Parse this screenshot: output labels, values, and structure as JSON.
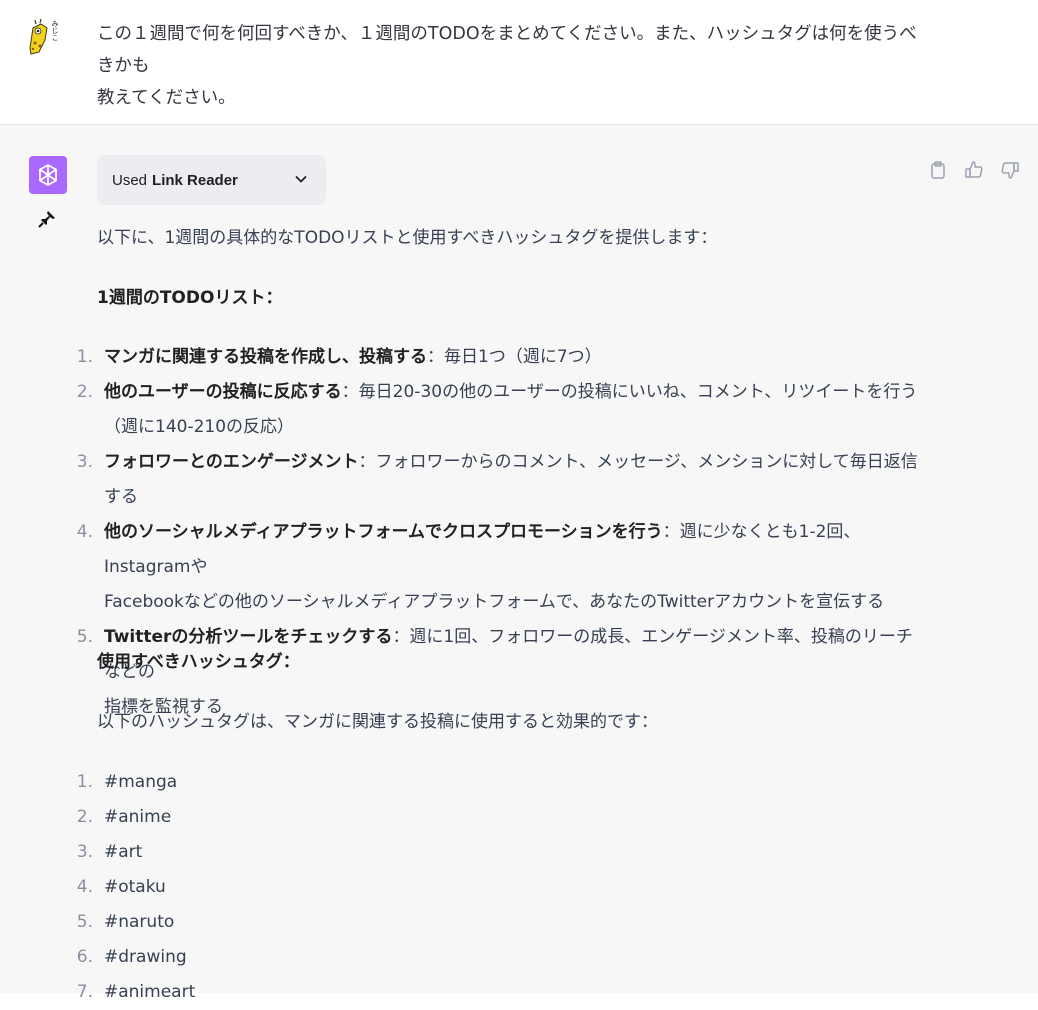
{
  "user": {
    "avatar_icon": "giraffe-avatar-icon",
    "avatar_text": "みじこ",
    "message_line1": "この１週間で何を何回すべきか、１週間のTODOをまとめてください。また、ハッシュタグは何を使うべきかも",
    "message_line2": "教えてください。"
  },
  "assistant": {
    "avatar_icon": "openai-logo-icon",
    "pin_icon": "pin-icon",
    "plugin": {
      "used_label": "Used",
      "name": "Link Reader",
      "chevron_icon": "chevron-down-icon"
    },
    "actions": {
      "copy_icon": "clipboard-icon",
      "like_icon": "thumbs-up-icon",
      "dislike_icon": "thumbs-down-icon"
    },
    "intro": "以下に、1週間の具体的なTODOリストと使用すべきハッシュタグを提供します：",
    "todo_heading": "1週間のTODOリスト：",
    "todos": [
      {
        "num": "1.",
        "title": "マンガに関連する投稿を作成し、投稿する",
        "line1": "：毎日1つ（週に7つ）",
        "line2": ""
      },
      {
        "num": "2.",
        "title": "他のユーザーの投稿に反応する",
        "line1": "：毎日20-30の他のユーザーの投稿にいいね、コメント、リツイートを行う",
        "line2": "（週に140-210の反応）"
      },
      {
        "num": "3.",
        "title": "フォロワーとのエンゲージメント",
        "line1": "：フォロワーからのコメント、メッセージ、メンションに対して毎日返信する",
        "line2": ""
      },
      {
        "num": "4.",
        "title": "他のソーシャルメディアプラットフォームでクロスプロモーションを行う",
        "line1": "：週に少なくとも1-2回、Instagramや",
        "line2": "Facebookなどの他のソーシャルメディアプラットフォームで、あなたのTwitterアカウントを宣伝する"
      },
      {
        "num": "5.",
        "title": "Twitterの分析ツールをチェックする",
        "line1": "：週に1回、フォロワーの成長、エンゲージメント率、投稿のリーチなどの",
        "line2": "指標を監視する"
      }
    ],
    "hashtag_heading": "使用すべきハッシュタグ：",
    "hashtag_intro": "以下のハッシュタグは、マンガに関連する投稿に使用すると効果的です：",
    "hashtags": [
      {
        "num": "1.",
        "tag": "#manga"
      },
      {
        "num": "2.",
        "tag": "#anime"
      },
      {
        "num": "3.",
        "tag": "#art"
      },
      {
        "num": "4.",
        "tag": "#otaku"
      },
      {
        "num": "5.",
        "tag": "#naruto"
      },
      {
        "num": "6.",
        "tag": "#drawing"
      },
      {
        "num": "7.",
        "tag": "#animeart"
      }
    ]
  }
}
